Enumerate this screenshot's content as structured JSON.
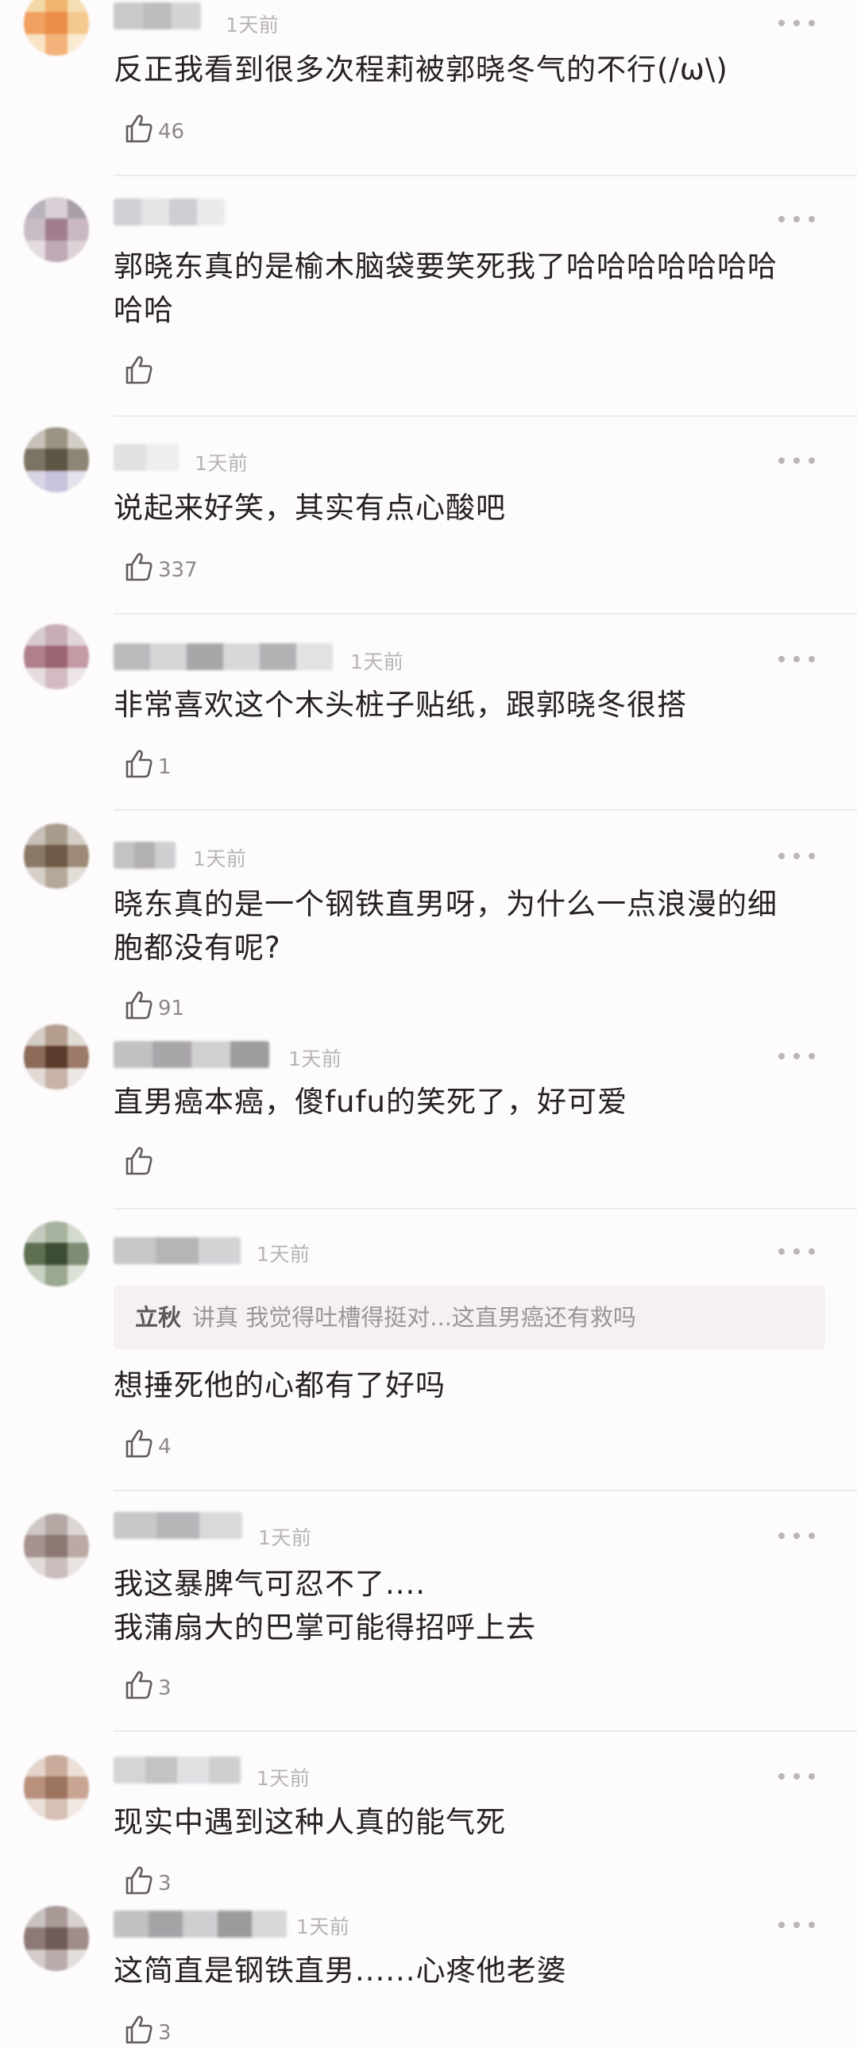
{
  "comments": [
    {
      "time": "1天前",
      "text": "反正我看到很多次程莉被郭晓冬气的不行(/ω\\)",
      "likes": "46",
      "avatar_colors": [
        "#f4d8a6",
        "#f0b46c",
        "#f6dfb4",
        "#f0a060",
        "#ec8d4a",
        "#f5c890",
        "#f8e4c4",
        "#f3b27a",
        "#f9ead2"
      ],
      "name_colors": [
        "#c9c9c9",
        "#bdbdbd",
        "#d4d4d4"
      ]
    },
    {
      "time": "",
      "text": "郭晓东真的是榆木脑袋要笑死我了哈哈哈哈哈哈哈\n哈哈",
      "likes": "",
      "avatar_colors": [
        "#b9b2bd",
        "#d8d0d6",
        "#a89ea8",
        "#c7bcc4",
        "#a07e8e",
        "#c9b8c2",
        "#e3dbe0",
        "#bfa9b6",
        "#dcd2d8"
      ],
      "name_colors": [
        "#d2d0d4",
        "#e6e4e7",
        "#cfcdd1",
        "#ebe9ec"
      ]
    },
    {
      "time": "1天前",
      "text": "说起来好笑，其实有点心酸吧",
      "likes": "337",
      "avatar_colors": [
        "#c7c1b9",
        "#9b9383",
        "#d2cdc6",
        "#7b7363",
        "#5c5744",
        "#8e8674",
        "#d9d4e4",
        "#c9c2dc",
        "#e4e0ec"
      ],
      "name_colors": [
        "#e2e0e3",
        "#eeedef"
      ]
    },
    {
      "time": "1天前",
      "text": "非常喜欢这个木头桩子贴纸，跟郭晓冬很搭",
      "likes": "1",
      "avatar_colors": [
        "#d8ccd0",
        "#c7adb6",
        "#e3d6da",
        "#b07f8a",
        "#9a6570",
        "#c49aa5",
        "#e6dde0",
        "#d2bcc2",
        "#ece4e7"
      ],
      "name_colors": [
        "#bdbabe",
        "#d6d4d7",
        "#a9a6aa",
        "#d9d7da",
        "#b4b1b5",
        "#e3e1e4"
      ]
    },
    {
      "time": "1天前",
      "text": "晓东真的是一个钢铁直男呀，为什么一点浪漫的细\n胞都没有呢?",
      "likes": "91",
      "avatar_colors": [
        "#c7c0b8",
        "#a89c8c",
        "#d5cfc8",
        "#8a7866",
        "#6e5a46",
        "#9d8a76",
        "#d6cfc8",
        "#b5a89a",
        "#e2ddd7"
      ],
      "name_colors": [
        "#c4c2c5",
        "#b3b0b4",
        "#d0ced1"
      ]
    },
    {
      "time": "1天前",
      "text": "直男癌本癌，傻fufu的笑死了，好可爱",
      "likes": "",
      "avatar_colors": [
        "#d4ccc6",
        "#b49c8e",
        "#e2dcd7",
        "#8b6a58",
        "#5b3b2c",
        "#9c7a68",
        "#e1dad5",
        "#c7b3a8",
        "#ece7e3"
      ],
      "name_colors": [
        "#c2c0c3",
        "#a9a6aa",
        "#d2d0d3",
        "#9f9ca0"
      ]
    },
    {
      "time": "1天前",
      "quote_name": "立秋",
      "quote_text": "讲真 我觉得吐槽得挺对...这直男癌还有救吗",
      "text": "想捶死他的心都有了好吗",
      "likes": "4",
      "avatar_colors": [
        "#c3cbbf",
        "#a6b39e",
        "#d3dace",
        "#5f7052",
        "#3d4d34",
        "#7d8c72",
        "#c8d0c2",
        "#9aa88f",
        "#dbe1d6"
      ],
      "name_colors": [
        "#c8c6c9",
        "#b7b4b8",
        "#d4d2d5"
      ]
    },
    {
      "time": "1天前",
      "text": "我这暴脾气可忍不了....\n我蒲扇大的巴掌可能得招呼上去",
      "likes": "3",
      "avatar_colors": [
        "#cfc7c5",
        "#b5a7a4",
        "#ddd6d4",
        "#a5918d",
        "#8c7873",
        "#bba9a5",
        "#e0dad8",
        "#c9bebb",
        "#e8e3e1"
      ],
      "name_colors": [
        "#c9c7ca",
        "#b8b5b9",
        "#dad8db"
      ]
    },
    {
      "time": "1天前",
      "text": "现实中遇到这种人真的能气死",
      "likes": "3",
      "avatar_colors": [
        "#e3d4cc",
        "#c9ab9b",
        "#ecdfd8",
        "#b8907c",
        "#9c735f",
        "#c8a592",
        "#ebdfd9",
        "#d6c0b5",
        "#f1e8e3"
      ],
      "name_colors": [
        "#d6d4d7",
        "#c4c2c5",
        "#e1dfe2",
        "#cfcdd0"
      ]
    },
    {
      "time": "1天前",
      "text": "这简直是钢铁直男......心疼他老婆",
      "likes": "3",
      "avatar_colors": [
        "#cac2c1",
        "#a99a98",
        "#d8d1d0",
        "#8d7a77",
        "#6f5b58",
        "#a08c89",
        "#d3cbca",
        "#b9acaa",
        "#e3dddc"
      ],
      "name_colors": [
        "#c2c0c3",
        "#a6a3a7",
        "#cfcdd0",
        "#9d9a9e",
        "#d8d6d9"
      ]
    }
  ],
  "icons": {
    "more": "more-dots-icon",
    "like": "thumbs-up-icon"
  }
}
